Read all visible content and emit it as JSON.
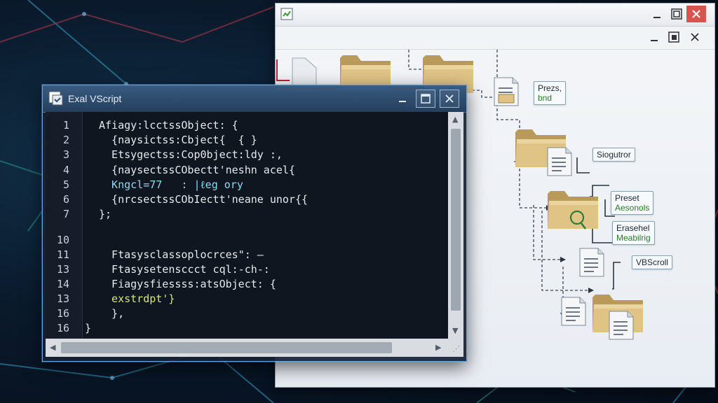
{
  "editor": {
    "title": "Exal VScript",
    "line_numbers": [
      "1",
      "2",
      "3",
      "4",
      "5",
      "6",
      "7",
      "10",
      "11",
      "13",
      "14",
      "13",
      "16",
      "16"
    ],
    "lines": [
      "Afiagy:lcctssObject: {",
      "  {naysictss:Cbject{  { }",
      "  Etsygectss:Cop0bject:ldy :,",
      "  {naysectssCObectt'neshn acel{",
      "  Kngcl=77   : |ℓeg ory",
      "  {nrcsectssCObIectt'neane unor{{",
      "};",
      "",
      "  Ftasysclassoplocrces\": —",
      "  Ftasysetensccct cql:-ch-:",
      "  Fiagysfiessss:atsObject: {",
      "  exstrdpt'}",
      "  },",
      "}"
    ]
  },
  "explorer": {
    "nodes": [
      {
        "line1": "Prezs,",
        "line2": "bnd"
      },
      {
        "line1": "Siogutror",
        "line2": ""
      },
      {
        "line1": "Preset",
        "line2": "Aesonols"
      },
      {
        "line1": "Erasehel",
        "line2": "Meabilrig"
      },
      {
        "line1": "VBScroll",
        "line2": ""
      }
    ]
  },
  "icons": {
    "app": "script-app-icon",
    "minimize": "minimize-icon",
    "maximize": "maximize-icon",
    "close": "close-icon",
    "folder": "folder-icon",
    "document": "document-icon"
  },
  "colors": {
    "accent": "#6fa2d2",
    "folder": "#d9b871",
    "close_bg": "#d9534f"
  }
}
